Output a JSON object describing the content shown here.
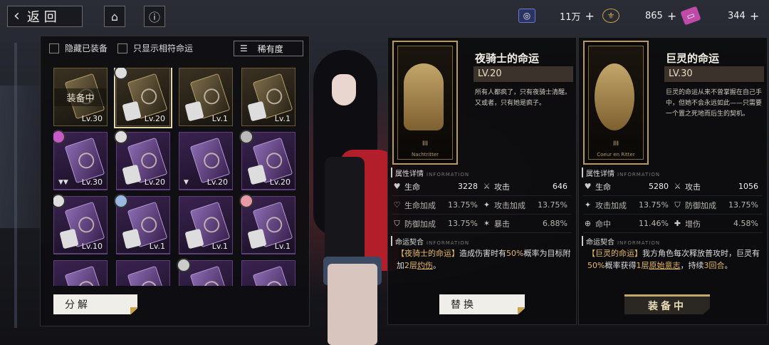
{
  "topbar": {
    "back_label": "返回",
    "home_icon": "home-icon",
    "info_icon": "info-icon",
    "resources": [
      {
        "icon": "currency-ring-icon",
        "value": "11万",
        "plus": "+",
        "color": "#4c5fb8"
      },
      {
        "icon": "fleur-de-lis-icon",
        "value": "865",
        "plus": "+",
        "color": "#c9a54a"
      },
      {
        "icon": "ticket-icon",
        "value": "344",
        "plus": "+",
        "color": "#c04aa8"
      }
    ]
  },
  "equipment": {
    "filter_hide_equipped": "隐藏已装备",
    "filter_matching": "只显示相符命运",
    "sort_label": "稀有度",
    "equipped_tag": "装备中",
    "decompose_label": "分解",
    "cards": [
      {
        "level": "Lv.30",
        "rarity": "gold",
        "equipped": true
      },
      {
        "level": "Lv.20",
        "rarity": "gold",
        "selected": true
      },
      {
        "level": "Lv.1",
        "rarity": "gold"
      },
      {
        "level": "Lv.1",
        "rarity": "gold"
      },
      {
        "level": "Lv.30",
        "rarity": "purple"
      },
      {
        "level": "Lv.20",
        "rarity": "purple"
      },
      {
        "level": "Lv.20",
        "rarity": "purple"
      },
      {
        "level": "Lv.20",
        "rarity": "purple"
      },
      {
        "level": "Lv.10",
        "rarity": "purple"
      },
      {
        "level": "Lv.1",
        "rarity": "purple"
      },
      {
        "level": "Lv.1",
        "rarity": "purple"
      },
      {
        "level": "Lv.1",
        "rarity": "purple"
      },
      {
        "level": "",
        "rarity": "purple"
      },
      {
        "level": "",
        "rarity": "purple"
      },
      {
        "level": "",
        "rarity": "purple"
      },
      {
        "level": "",
        "rarity": "purple"
      }
    ]
  },
  "fate_left": {
    "name": "夜骑士的命运",
    "level": "LV.20",
    "card_numeral": "III",
    "card_caption": "Nachtritter",
    "description": "所有人都疯了，只有夜骑士清醒。又或者，只有她是疯子。",
    "attr_title": "属性详情",
    "attr_title_en": "INFORMATION",
    "stats": [
      [
        {
          "icon": "heart-icon",
          "name": "生命",
          "value": "3228"
        },
        {
          "icon": "sword-icon",
          "name": "攻击",
          "value": "646"
        }
      ],
      [
        {
          "icon": "hp-bonus-icon",
          "name": "生命加成",
          "value": "13.75%"
        },
        {
          "icon": "atk-bonus-icon",
          "name": "攻击加成",
          "value": "13.75%"
        }
      ],
      [
        {
          "icon": "shield-icon",
          "name": "防御加成",
          "value": "13.75%"
        },
        {
          "icon": "crit-icon",
          "name": "暴击",
          "value": "6.88%"
        }
      ]
    ],
    "bond_title": "命运契合",
    "bond_title_en": "INFORMATION",
    "bond": {
      "prefix": "【夜骑士的命运】",
      "t1": "造成伤害时有",
      "p1": "50%",
      "t2": "概率为目标附加",
      "p2": "2层",
      "p3": "灼伤",
      "t3": "。"
    },
    "button": "替换"
  },
  "fate_right": {
    "name": "巨灵的命运",
    "level": "LV.30",
    "card_numeral": "III",
    "card_caption": "Coeur en Ritter",
    "description": "巨灵的命运从来不曾掌握在自己手中，但她不会永远如此——只需要一个置之死地而后生的契机。",
    "attr_title": "属性详情",
    "attr_title_en": "INFORMATION",
    "stats": [
      [
        {
          "icon": "heart-icon",
          "name": "生命",
          "value": "5280"
        },
        {
          "icon": "sword-icon",
          "name": "攻击",
          "value": "1056"
        }
      ],
      [
        {
          "icon": "atk-bonus-icon",
          "name": "攻击加成",
          "value": "13.75%"
        },
        {
          "icon": "shield-icon",
          "name": "防御加成",
          "value": "13.75%"
        }
      ],
      [
        {
          "icon": "target-icon",
          "name": "命中",
          "value": "11.46%"
        },
        {
          "icon": "damage-up-icon",
          "name": "增伤",
          "value": "4.58%"
        }
      ]
    ],
    "bond_title": "命运契合",
    "bond_title_en": "INFORMATION",
    "bond": {
      "prefix": "【巨灵的命运】",
      "t1": "我方角色每次释放普攻时，巨灵有",
      "p1": "50%",
      "t2": "概率获得",
      "p2": "1层",
      "p3": "原始意志",
      "t3": "，持续",
      "p4": "3回合",
      "t4": "。"
    },
    "button": "装备中"
  }
}
